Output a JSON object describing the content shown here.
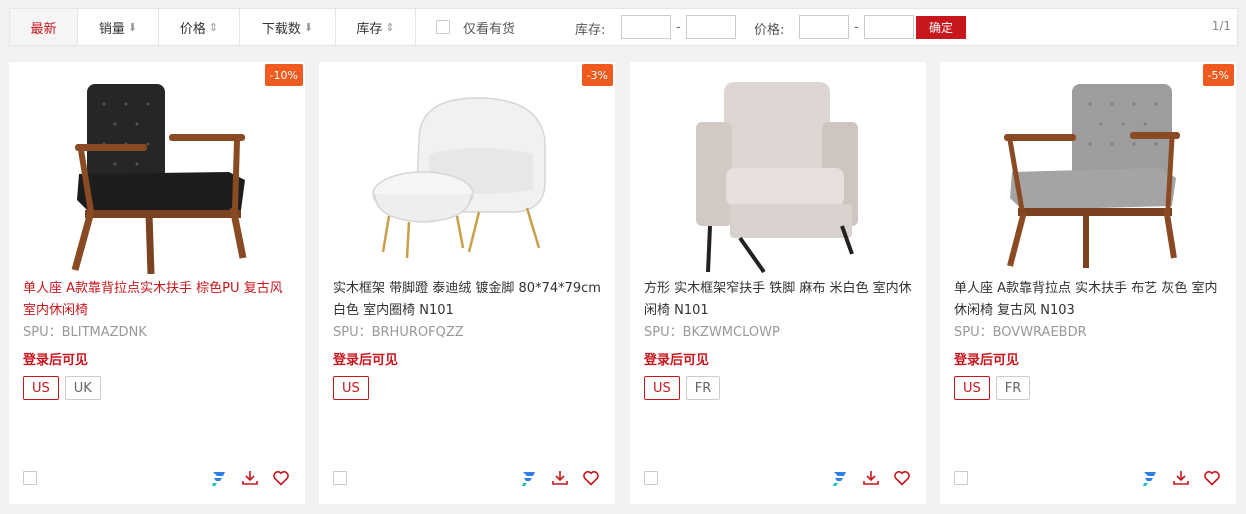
{
  "toolbar": {
    "sorts": [
      {
        "label": "最新",
        "arrow": ""
      },
      {
        "label": "销量",
        "arrow": "⬇"
      },
      {
        "label": "价格",
        "arrow": "⇕"
      },
      {
        "label": "下载数",
        "arrow": "⬇"
      },
      {
        "label": "库存",
        "arrow": "⇕"
      }
    ],
    "in_stock_label": "仅看有货",
    "stock_label": "库存:",
    "price_label": "价格:",
    "dash": "-",
    "confirm_label": "确定",
    "pager": "1/1"
  },
  "products": [
    {
      "discount": "-10%",
      "title": "单人座 A款靠背拉点实木扶手 棕色PU 复古风 室内休闲椅",
      "spu": "SPU：BLITMAZDNK",
      "login_text": "登录后可见",
      "tags": [
        "US",
        "UK"
      ]
    },
    {
      "discount": "-3%",
      "title": "实木框架 带脚蹬 泰迪绒 镀金脚 80*74*79cm 白色 室内圈椅 N101",
      "spu": "SPU：BRHUROFQZZ",
      "login_text": "登录后可见",
      "tags": [
        "US"
      ]
    },
    {
      "discount": "",
      "title": "方形 实木框架窄扶手 铁脚 麻布 米白色 室内休闲椅 N101",
      "spu": "SPU：BKZWMCLOWP",
      "login_text": "登录后可见",
      "tags": [
        "US",
        "FR"
      ]
    },
    {
      "discount": "-5%",
      "title": "单人座 A款靠背拉点 实木扶手 布艺 灰色 室内休闲椅 复古风 N103",
      "spu": "SPU：BOVWRAEBDR",
      "login_text": "登录后可见",
      "tags": [
        "US",
        "FR"
      ]
    }
  ],
  "icons": {
    "fast": "brand-f-icon",
    "download": "download-icon",
    "favorite": "heart-icon"
  },
  "colors": {
    "accent": "#c8161d",
    "badge": "#f05a1e",
    "brand_icon": "#2f7fe8"
  }
}
